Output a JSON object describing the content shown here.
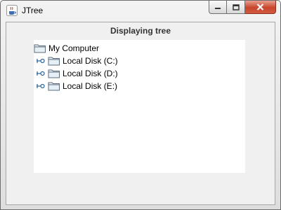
{
  "window": {
    "title": "JTree",
    "icon": "java-coffee-cup-icon",
    "controls": [
      "minimize-icon",
      "maximize-icon",
      "close-icon"
    ]
  },
  "content": {
    "heading": "Displaying tree"
  },
  "tree": {
    "root": {
      "label": "My Computer",
      "icon": "folder-icon",
      "expanded": true
    },
    "children": [
      {
        "label": "Local Disk (C:)",
        "icon": "folder-icon",
        "expanded": false
      },
      {
        "label": "Local Disk (D:)",
        "icon": "folder-icon",
        "expanded": false
      },
      {
        "label": "Local Disk (E:)",
        "icon": "folder-icon",
        "expanded": false
      }
    ]
  },
  "colors": {
    "close_button": "#c8452c",
    "client_bg": "#f0f0f0",
    "tree_bg": "#ffffff",
    "tree_handle": "#2a6496"
  }
}
